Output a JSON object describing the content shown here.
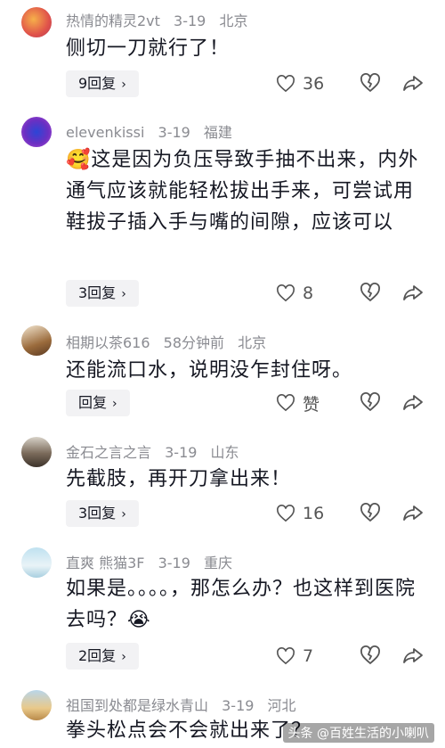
{
  "comments": [
    {
      "username": "热情的精灵2vt",
      "date": "3-19",
      "location": "北京",
      "text": "侧切一刀就行了！",
      "replies": "9回复",
      "likes": "36"
    },
    {
      "username": "elevenkissi",
      "date": "3-19",
      "location": "福建",
      "emoji": "🥰",
      "text": "这是因为负压导致手抽不出来，内外通气应该就能轻松拔出手来，可尝试用鞋拔子插入手与嘴的间隙，应该可以",
      "replies": "3回复",
      "likes": "8"
    },
    {
      "username": "相期以茶616",
      "date": "58分钟前",
      "location": "北京",
      "text": "还能流口水，说明没乍封住呀。",
      "replies": "回复",
      "likes": "赞"
    },
    {
      "username": "金石之言之言",
      "date": "3-19",
      "location": "山东",
      "text": "先截肢，再开刀拿出来！",
      "replies": "3回复",
      "likes": "16"
    },
    {
      "username": "直爽 熊猫3F",
      "date": "3-19",
      "location": "重庆",
      "text": "如果是。。。。，那怎么办？也这样到医院去吗？",
      "emoji_end": "😭",
      "replies": "2回复",
      "likes": "7"
    },
    {
      "username": "祖国到处都是绿水青山",
      "date": "3-19",
      "location": "河北",
      "text": "拳头松点会不会就出来了？",
      "replies": "",
      "likes": ""
    }
  ],
  "watermark": "头条 @百姓生活的小喇叭",
  "chevron": "›",
  "colors": {
    "meta": "#8a8b91",
    "pill": "#f2f2f4",
    "text": "#161823"
  }
}
